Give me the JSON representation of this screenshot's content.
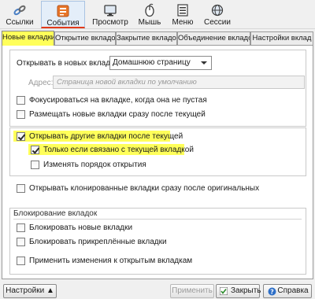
{
  "toolbar": {
    "items": [
      {
        "label": "Ссылки",
        "icon": "link-chain-icon"
      },
      {
        "label": "События",
        "icon": "events-panel-icon",
        "active": true
      },
      {
        "label": "Просмотр",
        "icon": "monitor-icon"
      },
      {
        "label": "Мышь",
        "icon": "mouse-icon"
      },
      {
        "label": "Меню",
        "icon": "menu-list-icon"
      },
      {
        "label": "Сессии",
        "icon": "sessions-globe-icon"
      }
    ]
  },
  "tabs": [
    {
      "label": "Новые вкладки",
      "active": true
    },
    {
      "label": "Открытие вкладок"
    },
    {
      "label": "Закрытие вкладок"
    },
    {
      "label": "Объединение вкладок"
    },
    {
      "label": "Настройки вклад"
    }
  ],
  "panel": {
    "open_in_new_label": "Открывать в новых вкладках:",
    "open_in_new_value": "Домашнюю страницу",
    "address_label": "Адрес:",
    "address_placeholder": "Страница новой вкладки по умолчанию",
    "focus_label": "Фокусироваться на вкладке, когда она не пустая",
    "place_after_label": "Размещать новые вкладки сразу после текущей",
    "open_others_after_label": "Открывать другие вкладки после текущей",
    "only_related_label": "Только если связано с текущей вкладкой",
    "change_order_label": "Изменять порядок открытия",
    "open_cloned_label": "Открывать клонированные вкладки сразу после оригинальных",
    "lock_group_title": "Блокирование вкладок",
    "lock_new_label": "Блокировать новые вкладки",
    "lock_pinned_label": "Блокировать прикреплённые вкладки",
    "apply_open_label": "Применить изменения к открытым вкладкам"
  },
  "checkboxes": {
    "focus": false,
    "place_after": false,
    "open_others_after": true,
    "only_related": true,
    "change_order": false,
    "open_cloned": false,
    "lock_new": false,
    "lock_pinned": false,
    "apply_open": false
  },
  "bottom": {
    "settings_label": "Настройки ▲",
    "apply_label": "Применить",
    "close_label": "Закрыть",
    "help_label": "Справка"
  },
  "colors": {
    "highlight": "#ffff5a",
    "active_underline": "#e23a1a",
    "help_icon": "#2e6fc7"
  }
}
